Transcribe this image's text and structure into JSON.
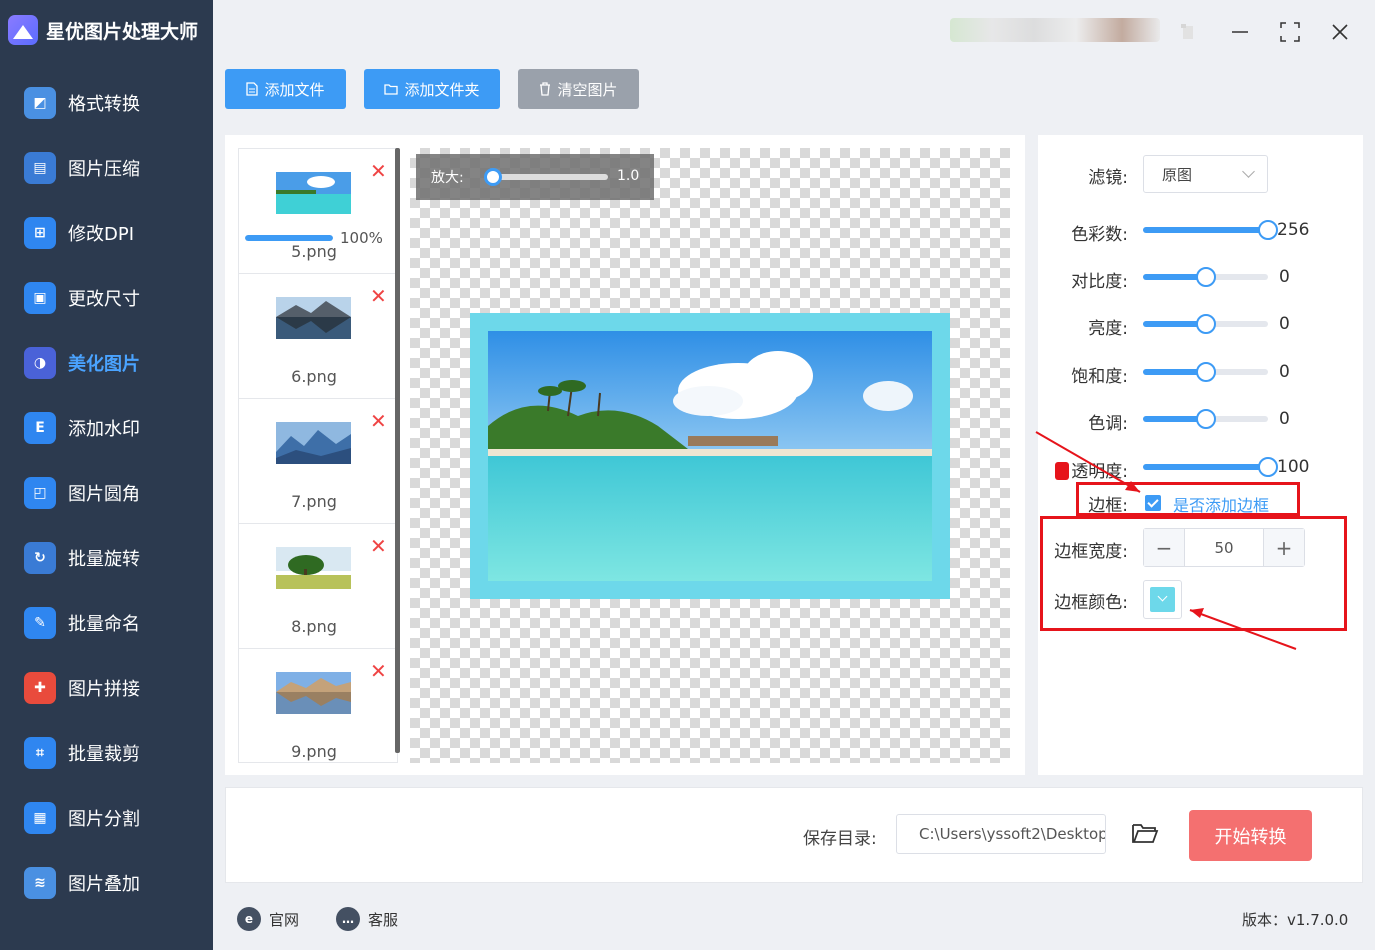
{
  "app": {
    "title": "星优图片处理大师"
  },
  "sidebar": {
    "items": [
      {
        "label": "格式转换",
        "icon": "image-convert-icon",
        "color": "#4a90e2",
        "glyph": "◩"
      },
      {
        "label": "图片压缩",
        "icon": "compress-icon",
        "color": "#3a7bd5",
        "glyph": "▤"
      },
      {
        "label": "修改DPI",
        "icon": "dpi-icon",
        "color": "#2f86f0",
        "glyph": "⊞"
      },
      {
        "label": "更改尺寸",
        "icon": "resize-icon",
        "color": "#2f86f0",
        "glyph": "▣"
      },
      {
        "label": "美化图片",
        "icon": "beautify-icon",
        "color": "#4a62d8",
        "glyph": "◑"
      },
      {
        "label": "添加水印",
        "icon": "watermark-icon",
        "color": "#2f86f0",
        "glyph": "E"
      },
      {
        "label": "图片圆角",
        "icon": "round-corner-icon",
        "color": "#2f86f0",
        "glyph": "◰"
      },
      {
        "label": "批量旋转",
        "icon": "rotate-icon",
        "color": "#3a7bd5",
        "glyph": "↻"
      },
      {
        "label": "批量命名",
        "icon": "rename-icon",
        "color": "#2f86f0",
        "glyph": "✎"
      },
      {
        "label": "图片拼接",
        "icon": "puzzle-icon",
        "color": "#e94b3c",
        "glyph": "✚"
      },
      {
        "label": "批量裁剪",
        "icon": "crop-icon",
        "color": "#2f86f0",
        "glyph": "⌗"
      },
      {
        "label": "图片分割",
        "icon": "split-icon",
        "color": "#2f86f0",
        "glyph": "▦"
      },
      {
        "label": "图片叠加",
        "icon": "layers-icon",
        "color": "#4a90e2",
        "glyph": "≋"
      }
    ],
    "active_index": 4
  },
  "toolbar": {
    "add_file": "添加文件",
    "add_folder": "添加文件夹",
    "clear": "清空图片"
  },
  "files": [
    {
      "name": "5.png",
      "progress_label": "100%",
      "progress": 1.0,
      "scene": "beach"
    },
    {
      "name": "6.png",
      "scene": "lake"
    },
    {
      "name": "7.png",
      "scene": "mountains"
    },
    {
      "name": "8.png",
      "scene": "tree"
    },
    {
      "name": "9.png",
      "scene": "reflection"
    }
  ],
  "preview": {
    "zoom_label": "放大:",
    "zoom_value": "1.0",
    "border_color": "#6dd8ea"
  },
  "settings": {
    "filter_label": "滤镜:",
    "filter_value": "原图",
    "sliders": [
      {
        "label": "色彩数:",
        "value": "256",
        "fraction": 1.0
      },
      {
        "label": "对比度:",
        "value": "0",
        "fraction": 0.5
      },
      {
        "label": "亮度:",
        "value": "0",
        "fraction": 0.5
      },
      {
        "label": "饱和度:",
        "value": "0",
        "fraction": 0.5
      },
      {
        "label": "色调:",
        "value": "0",
        "fraction": 0.5
      },
      {
        "label": "透明度:",
        "value": "100",
        "fraction": 1.0
      }
    ],
    "border_label": "边框:",
    "border_checkbox_label": "是否添加边框",
    "border_checked": true,
    "border_width_label": "边框宽度:",
    "border_width_value": "50",
    "border_color_label": "边框颜色:",
    "border_color": "#6dd8ea"
  },
  "bottom": {
    "save_label": "保存目录:",
    "save_path": "C:\\Users\\yssoft2\\Desktop",
    "start_button": "开始转换"
  },
  "footer": {
    "website": "官网",
    "support": "客服",
    "version": "版本：v1.7.0.0"
  },
  "colors": {
    "sidebar_bg": "#2c3a4f",
    "accent": "#3d9bf5",
    "start_button": "#f47070",
    "highlight": "#e6141b"
  }
}
